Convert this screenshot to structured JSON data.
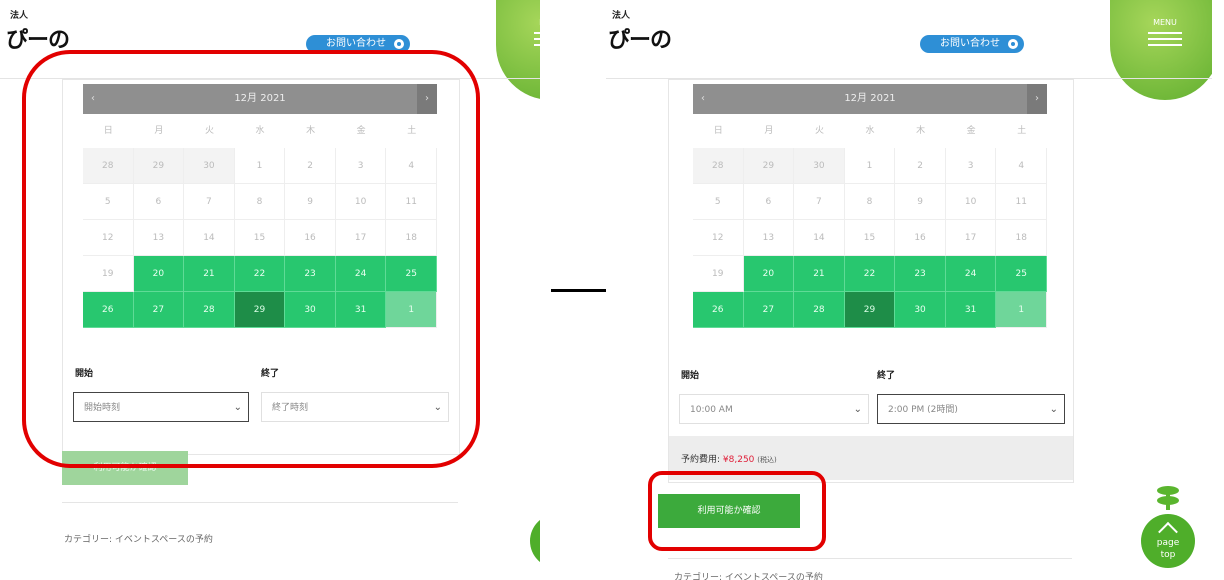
{
  "brand": {
    "small": "法人",
    "name": "ぴーの"
  },
  "header": {
    "inquiry_label": "お問い合わせ",
    "menu_label": "MENU"
  },
  "calendar": {
    "month_label": "12月 2021",
    "prev_label": "‹",
    "next_label": "›",
    "weekdays": [
      "日",
      "月",
      "火",
      "水",
      "木",
      "金",
      "土"
    ],
    "weeks": [
      [
        "28",
        "29",
        "30",
        "1",
        "2",
        "3",
        "4"
      ],
      [
        "5",
        "6",
        "7",
        "8",
        "9",
        "10",
        "11"
      ],
      [
        "12",
        "13",
        "14",
        "15",
        "16",
        "17",
        "18"
      ],
      [
        "19",
        "20",
        "21",
        "22",
        "23",
        "24",
        "25"
      ],
      [
        "26",
        "27",
        "28",
        "29",
        "30",
        "31",
        "1"
      ]
    ],
    "colors": {
      "available": "#28c76f",
      "selected": "#1e8d48",
      "next_month": "#6fd69a"
    }
  },
  "form": {
    "start_label": "開始",
    "end_label": "終了",
    "left": {
      "start_value": "開始時刻",
      "end_value": "終了時刻"
    },
    "right": {
      "start_value": "10:00 AM",
      "end_value": "2:00 PM (2時間)"
    }
  },
  "fee": {
    "label": "予約費用:",
    "amount": "¥8,250",
    "tax": "(税込)"
  },
  "button": {
    "label": "利用可能か確認"
  },
  "category": "カテゴリー: イベントスペースの予約",
  "pagetop": {
    "line1": "page",
    "line2": "top"
  },
  "annotation_color": "#e20000"
}
